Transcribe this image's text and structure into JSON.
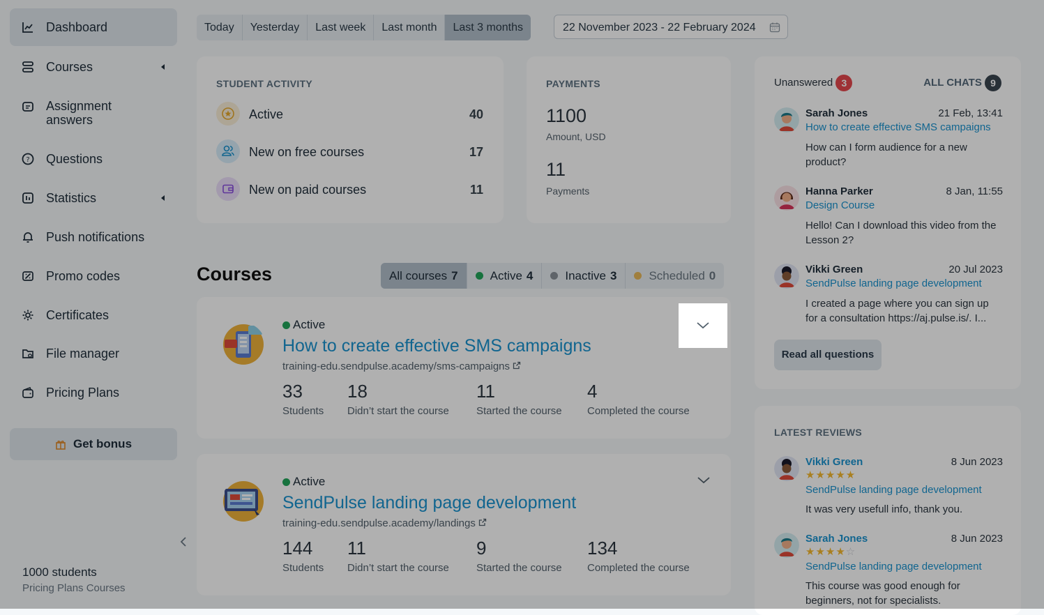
{
  "sidebar": {
    "items": [
      {
        "label": "Dashboard",
        "icon": "chart-line-icon"
      },
      {
        "label": "Courses",
        "icon": "layers-icon"
      },
      {
        "label": "Assignment answers",
        "icon": "chat-square-icon"
      },
      {
        "label": "Questions",
        "icon": "question-circle-icon"
      },
      {
        "label": "Statistics",
        "icon": "stats-icon"
      },
      {
        "label": "Push notifications",
        "icon": "bell-icon"
      },
      {
        "label": "Promo codes",
        "icon": "ticket-icon"
      },
      {
        "label": "Certificates",
        "icon": "gear-icon"
      },
      {
        "label": "File manager",
        "icon": "folder-icon"
      },
      {
        "label": "Pricing Plans",
        "icon": "wallet-icon"
      }
    ],
    "bonus_label": "Get bonus",
    "footer_students": "1000 students",
    "footer_plan": "Pricing Plans Courses"
  },
  "filters": {
    "periods": [
      "Today",
      "Yesterday",
      "Last week",
      "Last month",
      "Last 3 months"
    ],
    "selected_period": "Last 3 months",
    "date_range": "22 November 2023 - 22 February 2024"
  },
  "student_activity": {
    "title": "STUDENT ACTIVITY",
    "rows": [
      {
        "label": "Active",
        "value": "40"
      },
      {
        "label": "New on free courses",
        "value": "17"
      },
      {
        "label": "New on paid courses",
        "value": "11"
      }
    ]
  },
  "payments": {
    "title": "PAYMENTS",
    "amount": "1100",
    "amount_label": "Amount, USD",
    "count": "11",
    "count_label": "Payments"
  },
  "courses": {
    "title": "Courses",
    "tabs": [
      {
        "label": "All courses",
        "count": "7"
      },
      {
        "label": "Active",
        "count": "4"
      },
      {
        "label": "Inactive",
        "count": "3"
      },
      {
        "label": "Scheduled",
        "count": "0"
      }
    ],
    "list": [
      {
        "status": "Active",
        "title": "How to create effective SMS campaigns",
        "url": "training-edu.sendpulse.academy/sms-campaigns",
        "stats": [
          {
            "value": "33",
            "label": "Students"
          },
          {
            "value": "18",
            "label": "Didn’t start the course"
          },
          {
            "value": "11",
            "label": "Started the course"
          },
          {
            "value": "4",
            "label": "Completed the course"
          }
        ]
      },
      {
        "status": "Active",
        "title": "SendPulse landing page development",
        "url": "training-edu.sendpulse.academy/landings",
        "stats": [
          {
            "value": "144",
            "label": "Students"
          },
          {
            "value": "11",
            "label": "Didn’t start the course"
          },
          {
            "value": "9",
            "label": "Started the course"
          },
          {
            "value": "134",
            "label": "Completed the course"
          }
        ]
      }
    ]
  },
  "chats": {
    "unanswered_label": "Unanswered",
    "unanswered_count": "3",
    "all_label": "ALL CHATS",
    "all_count": "9",
    "items": [
      {
        "name": "Sarah Jones",
        "date": "21 Feb, 13:41",
        "course": "How to create effective SMS campaigns",
        "message": "How can I form audience for a new product?"
      },
      {
        "name": "Hanna Parker",
        "date": "8 Jan, 11:55",
        "course": "Design Course",
        "message": "Hello! Can I download this video from the Lesson 2?"
      },
      {
        "name": "Vikki Green",
        "date": "20 Jul 2023",
        "course": "SendPulse landing page development",
        "message": "I created a page where you can sign up for a consultation https://aj.pulse.is/. I..."
      }
    ],
    "read_all_label": "Read all questions"
  },
  "reviews": {
    "title": "LATEST REVIEWS",
    "items": [
      {
        "name": "Vikki Green",
        "date": "8 Jun 2023",
        "rating": 5,
        "course": "SendPulse landing page development",
        "text": "It was very usefull info, thank you."
      },
      {
        "name": "Sarah Jones",
        "date": "8 Jun 2023",
        "rating": 4,
        "course": "SendPulse landing page development",
        "text": "This course was good enough for beginners, not for specialists."
      }
    ]
  },
  "colors": {
    "accent": "#1a93d0",
    "active_dot": "#22a65a",
    "inactive_dot": "#8a9299",
    "scheduled_dot": "#e8b85a",
    "badge_red": "#e5484d"
  }
}
